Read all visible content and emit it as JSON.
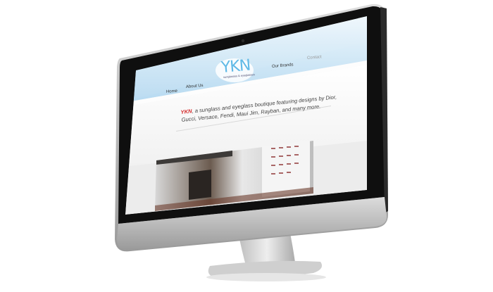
{
  "site": {
    "logo_text": "YKN",
    "logo_subtitle": "sunglasses & eyeglasses"
  },
  "nav": {
    "items": [
      {
        "label": "Home"
      },
      {
        "label": "About Us"
      },
      {
        "label": "Our Brands"
      },
      {
        "label": "Contact"
      }
    ]
  },
  "intro": {
    "brand": "YKN",
    "text": ", a sunglass and eyeglass boutique featuring designs by Dior, Gucci, Versace, Fendi, Maui Jim, Rayban, and many more."
  },
  "colors": {
    "header_gradient_top": "#e9f4fb",
    "header_gradient_bottom": "#b9dcf2",
    "accent": "#5fb9e6",
    "brand_red": "#d32a2a",
    "bezel": "#111111",
    "stand": "#c9c9c9"
  }
}
